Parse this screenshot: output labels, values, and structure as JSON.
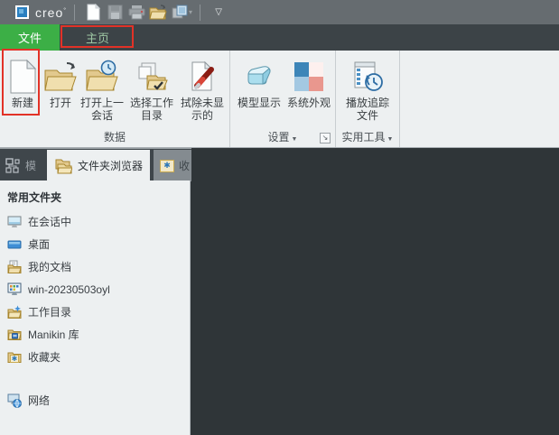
{
  "titlebar": {
    "logo_text": "creo",
    "logo_mark": "°"
  },
  "glyphs": {
    "dropdown_small": "▼",
    "quick_access_dropdown": "▽",
    "window_dropdown": "▾",
    "launcher": "↘",
    "asterisk": "✱"
  },
  "ribbon_tabs": {
    "file": "文件",
    "home": "主页"
  },
  "ribbon": {
    "groups": [
      {
        "label": "数据",
        "buttons": [
          {
            "line1": "新建",
            "line2": ""
          },
          {
            "line1": "打开",
            "line2": ""
          },
          {
            "line1": "打开上一",
            "line2": "会话"
          },
          {
            "line1": "选择工作",
            "line2": "目录"
          },
          {
            "line1": "拭除未显",
            "line2": "示的"
          }
        ]
      },
      {
        "label": "设置",
        "buttons": [
          {
            "line1": "模型显示",
            "line2": ""
          },
          {
            "line1": "系统外观",
            "line2": ""
          }
        ]
      },
      {
        "label": "实用工具",
        "buttons": [
          {
            "line1": "播放追踪",
            "line2": "文件"
          }
        ]
      }
    ]
  },
  "navigator": {
    "tabs": {
      "model_tree": "模",
      "folder_browser": "文件夹浏览器",
      "favorites": "收"
    },
    "section_header": "常用文件夹",
    "items": [
      {
        "label": "在会话中"
      },
      {
        "label": "桌面"
      },
      {
        "label": "我的文档"
      },
      {
        "label": "win-20230503oyl"
      },
      {
        "label": "工作目录"
      },
      {
        "label": "Manikin 库"
      },
      {
        "label": "收藏夹"
      },
      {
        "label": "网络"
      }
    ]
  },
  "colors": {
    "accent_green": "#3caf46",
    "annotation_red": "#e23227",
    "titlebar_bg": "#666c70",
    "tabrow_bg": "#3c4347",
    "ribbon_bg": "#edf0f1",
    "canvas_bg": "#2f3538"
  }
}
